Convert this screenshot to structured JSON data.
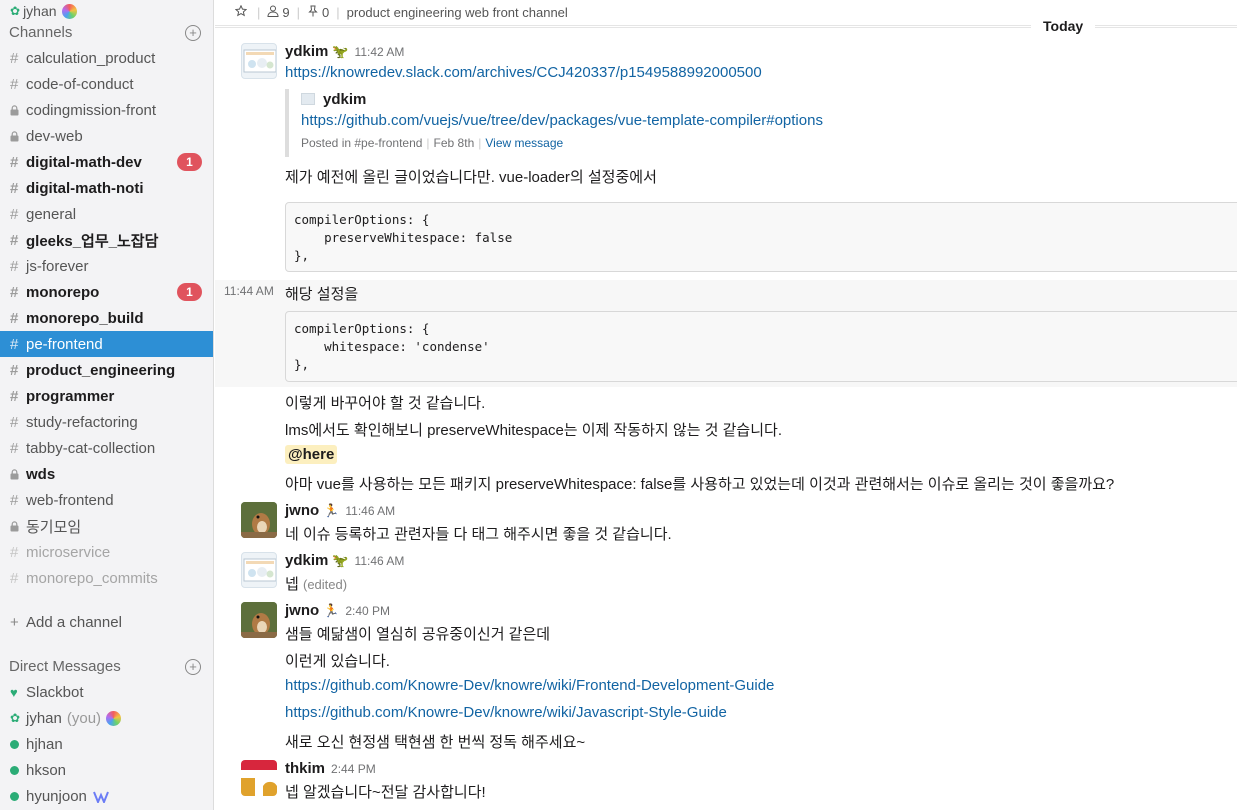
{
  "sidebar": {
    "user": "jyhan",
    "channels_header": "Channels",
    "channels": [
      {
        "name": "calculation_product",
        "type": "public",
        "style": "normal",
        "badge": ""
      },
      {
        "name": "code-of-conduct",
        "type": "public",
        "style": "normal",
        "badge": ""
      },
      {
        "name": "codingmission-front",
        "type": "private",
        "style": "normal",
        "badge": ""
      },
      {
        "name": "dev-web",
        "type": "private",
        "style": "normal",
        "badge": ""
      },
      {
        "name": "digital-math-dev",
        "type": "public",
        "style": "bold",
        "badge": "1"
      },
      {
        "name": "digital-math-noti",
        "type": "public",
        "style": "bold",
        "badge": ""
      },
      {
        "name": "general",
        "type": "public",
        "style": "normal",
        "badge": ""
      },
      {
        "name": "gleeks_업무_노잡담",
        "type": "public",
        "style": "bold",
        "badge": ""
      },
      {
        "name": "js-forever",
        "type": "public",
        "style": "normal",
        "badge": ""
      },
      {
        "name": "monorepo",
        "type": "public",
        "style": "bold",
        "badge": "1"
      },
      {
        "name": "monorepo_build",
        "type": "public",
        "style": "bold",
        "badge": ""
      },
      {
        "name": "pe-frontend",
        "type": "public",
        "style": "active",
        "badge": ""
      },
      {
        "name": "product_engineering",
        "type": "public",
        "style": "bold",
        "badge": ""
      },
      {
        "name": "programmer",
        "type": "public",
        "style": "bold",
        "badge": ""
      },
      {
        "name": "study-refactoring",
        "type": "public",
        "style": "normal",
        "badge": ""
      },
      {
        "name": "tabby-cat-collection",
        "type": "public",
        "style": "normal",
        "badge": ""
      },
      {
        "name": "wds",
        "type": "private",
        "style": "bold",
        "badge": ""
      },
      {
        "name": "web-frontend",
        "type": "public",
        "style": "normal",
        "badge": ""
      },
      {
        "name": "동기모임",
        "type": "private",
        "style": "normal",
        "badge": ""
      },
      {
        "name": "microservice",
        "type": "public",
        "style": "muted",
        "badge": ""
      },
      {
        "name": "monorepo_commits",
        "type": "public",
        "style": "muted",
        "badge": ""
      }
    ],
    "add_channel": "Add a channel",
    "dm_header": "Direct Messages",
    "dms": [
      {
        "name": "Slackbot",
        "presence": "heart",
        "suffix": ""
      },
      {
        "name": "jyhan",
        "presence": "leaf",
        "suffix": "(you)"
      },
      {
        "name": "hjhan",
        "presence": "dot",
        "suffix": ""
      },
      {
        "name": "hkson",
        "presence": "dot",
        "suffix": ""
      },
      {
        "name": "hyunjoon",
        "presence": "dot",
        "suffix": ""
      }
    ]
  },
  "topbar": {
    "members": "9",
    "pins": "0",
    "topic": "product engineering web front channel"
  },
  "day_divider": "Today",
  "messages": {
    "m1": {
      "name": "ydkim",
      "time": "11:42 AM",
      "link": "https://knowredev.slack.com/archives/CCJ420337/p1549588992000500",
      "attach_name": "ydkim",
      "attach_link": "https://github.com/vuejs/vue/tree/dev/packages/vue-template-compiler#options",
      "attach_posted": "Posted in #pe-frontend",
      "attach_date": "Feb 8th",
      "attach_view": "View message",
      "text": "제가 예전에 올린 글이었습니다만. vue-loader의 설정중에서",
      "code1": "compilerOptions: {\n    preserveWhitespace: false\n},",
      "side_time": "11:44 AM",
      "text2": "해당 설정을",
      "code2": "compilerOptions: {\n    whitespace: 'condense'\n},",
      "text3": "이렇게 바꾸어야 할 것 같습니다.",
      "text4": "lms에서도 확인해보니 preserveWhitespace는 이제 작동하지 않는 것 같습니다.",
      "here": "@here",
      "text5": "아마 vue를 사용하는 모든 패키지 preserveWhitespace: false를 사용하고 있었는데 이것과 관련해서는 이슈로 올리는 것이 좋을까요?"
    },
    "m2": {
      "name": "jwno",
      "time": "11:46 AM",
      "text": "네 이슈 등록하고 관련자들 다 태그 해주시면 좋을 것 같습니다."
    },
    "m3": {
      "name": "ydkim",
      "time": "11:46 AM",
      "text": "넵",
      "edited": "(edited)"
    },
    "m4": {
      "name": "jwno",
      "time": "2:40 PM",
      "text": "샘들 예닮샘이 열심히 공유중이신거 같은데",
      "text2": "이런게 있습니다.",
      "link1": "https://github.com/Knowre-Dev/knowre/wiki/Frontend-Development-Guide",
      "link2": "https://github.com/Knowre-Dev/knowre/wiki/Javascript-Style-Guide",
      "text3": "새로 오신 현정샘 택현샘 한 번씩 정독 해주세요~"
    },
    "m5": {
      "name": "thkim",
      "time": "2:44 PM",
      "text": "넵 알겠습니다~전달 감사합니다!"
    }
  }
}
